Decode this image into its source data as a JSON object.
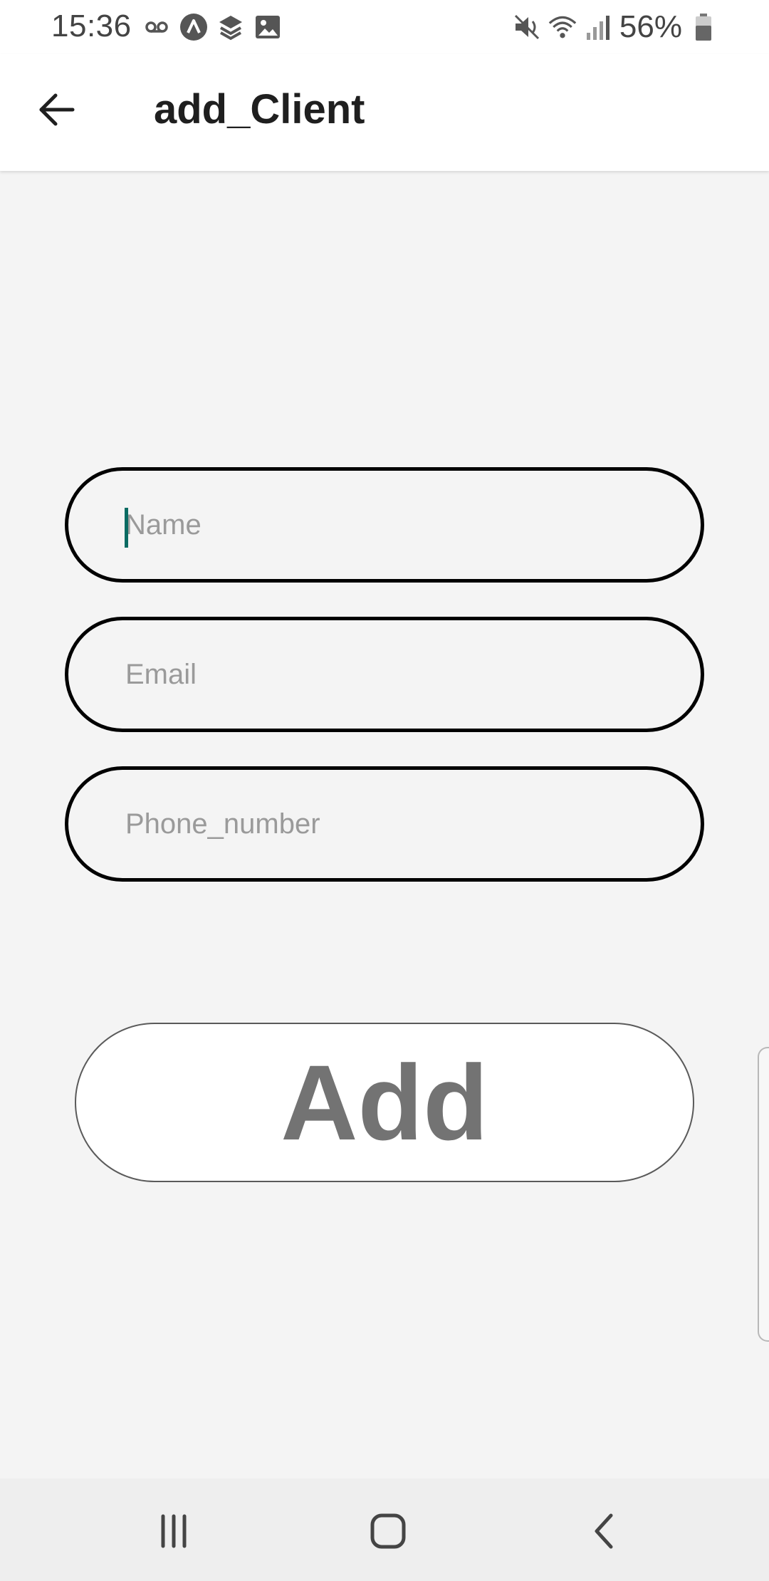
{
  "status_bar": {
    "time": "15:36",
    "battery_percent": "56%",
    "left_icons": [
      "voicemail-icon",
      "app-a-icon",
      "layers-icon",
      "image-icon"
    ],
    "right_icons": [
      "mute-icon",
      "wifi-icon",
      "signal-icon",
      "battery-icon"
    ]
  },
  "app_bar": {
    "title": "add_Client",
    "back_icon": "arrow-left-icon"
  },
  "form": {
    "name_placeholder": "Name",
    "name_value": "",
    "email_placeholder": "Email",
    "email_value": "",
    "phone_placeholder": "Phone_number",
    "phone_value": "",
    "focused_field": "name"
  },
  "add_button": {
    "label": "Add"
  },
  "nav_bar": {
    "icons": [
      "recent-apps-icon",
      "home-icon",
      "back-icon"
    ]
  },
  "colors": {
    "background": "#f4f4f4",
    "app_bar": "#ffffff",
    "input_border": "#000000",
    "placeholder": "#9a9a9a",
    "caret": "#0a6b62",
    "button_text": "#737373",
    "nav_bar": "#eeeeee"
  }
}
